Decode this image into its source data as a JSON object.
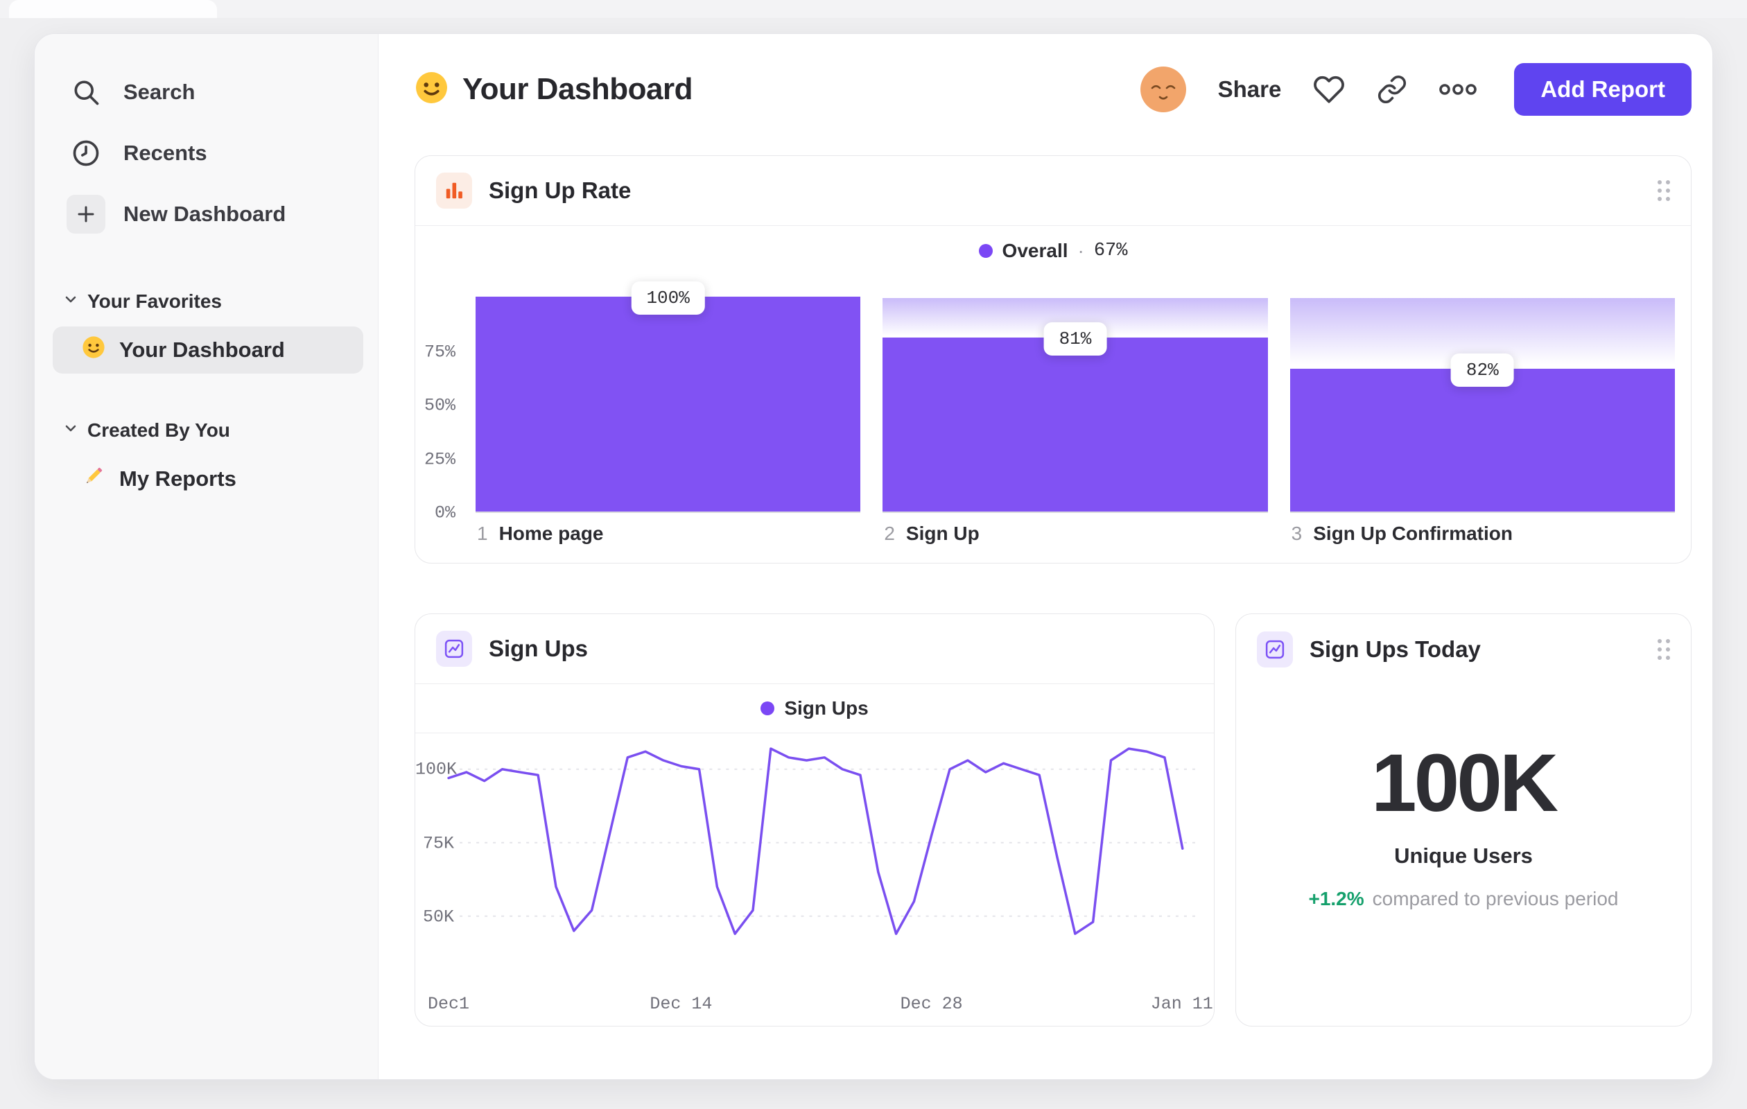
{
  "sidebar": {
    "search": "Search",
    "recents": "Recents",
    "new_dashboard": "New Dashboard",
    "favorites_section": "Your Favorites",
    "favorite_item": "Your Dashboard",
    "created_section": "Created By You",
    "created_item": "My Reports"
  },
  "header": {
    "title": "Your Dashboard",
    "share": "Share",
    "add_report": "Add Report"
  },
  "colors": {
    "accent_purple": "#7B47F5",
    "bar_purple": "#8152F3",
    "line_purple": "#7A4FF0",
    "button_purple": "#5F44F0",
    "delta_green": "#15A06C",
    "funnel_icon_orange": "#F05B24"
  },
  "chart_data": [
    {
      "type": "bar",
      "title": "Sign Up Rate",
      "legend": {
        "label": "Overall",
        "separator": "·",
        "value": "67%"
      },
      "ylim": [
        0,
        100
      ],
      "y_ticks": [
        {
          "label": "75%",
          "value": 75
        },
        {
          "label": "50%",
          "value": 50
        },
        {
          "label": "25%",
          "value": 25
        },
        {
          "label": "0%",
          "value": 0
        }
      ],
      "steps": [
        {
          "index": "1",
          "label": "Home page",
          "badge": "100%",
          "height_pct": 100
        },
        {
          "index": "2",
          "label": "Sign Up",
          "badge": "81%",
          "height_pct": 81
        },
        {
          "index": "3",
          "label": "Sign Up Confirmation",
          "badge": "82%",
          "height_pct": 66.4
        }
      ]
    },
    {
      "type": "line",
      "title": "Sign Ups",
      "legend": {
        "label": "Sign Ups"
      },
      "unit": "K",
      "ylim": [
        30,
        115
      ],
      "y_ticks": [
        {
          "label": "100K",
          "value": 100
        },
        {
          "label": "75K",
          "value": 75
        },
        {
          "label": "50K",
          "value": 50
        }
      ],
      "x_ticks": [
        {
          "label": "Dec1",
          "day": 0
        },
        {
          "label": "Dec 14",
          "day": 13
        },
        {
          "label": "Dec 28",
          "day": 27
        },
        {
          "label": "Jan 11",
          "day": 41
        }
      ],
      "points_k": [
        97,
        99,
        96,
        100,
        99,
        98,
        60,
        45,
        52,
        78,
        104,
        106,
        103,
        101,
        100,
        60,
        44,
        52,
        107,
        104,
        103,
        104,
        100,
        98,
        65,
        44,
        55,
        78,
        100,
        103,
        99,
        102,
        100,
        98,
        70,
        44,
        48,
        103,
        107,
        106,
        104,
        73
      ]
    },
    {
      "type": "metric",
      "title": "Sign Ups Today",
      "value": "100K",
      "label": "Unique Users",
      "delta": "+1.2%",
      "delta_note": "compared to previous period"
    }
  ]
}
